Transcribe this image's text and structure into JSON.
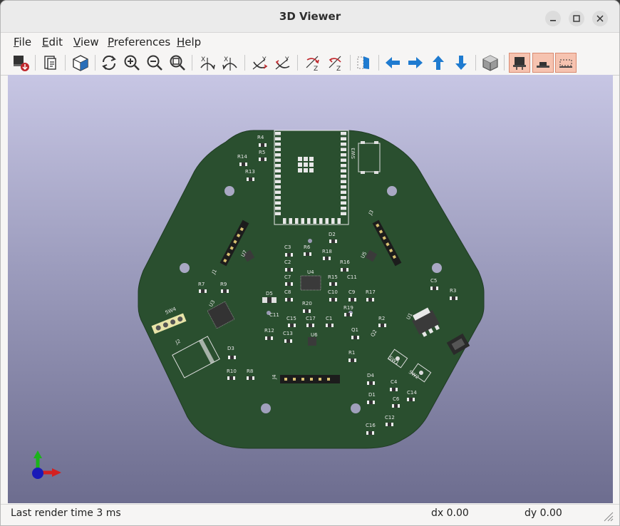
{
  "window": {
    "title": "3D Viewer"
  },
  "menu": {
    "file": "File",
    "edit": "Edit",
    "view": "View",
    "preferences": "Preferences",
    "help": "Help",
    "file_u": "F",
    "file_r": "ile",
    "edit_u": "E",
    "edit_r": "dit",
    "view_u": "V",
    "view_r": "iew",
    "pref_u": "P",
    "pref_r": "references",
    "help_u": "H",
    "help_r": "elp"
  },
  "toolbar": {
    "active_color": "#f6c3b0",
    "icon_blue": "#1f7bd0"
  },
  "board": {
    "color": "#2a4f2f",
    "labels": [
      "R4",
      "R5",
      "R14",
      "R13",
      "SW3",
      "J3",
      "D2",
      "R6",
      "R18",
      "C3",
      "U7",
      "C2",
      "R16",
      "U5",
      "J1",
      "C7",
      "U4",
      "R15",
      "C11",
      "C5",
      "R7",
      "R9",
      "C8",
      "C10",
      "C9",
      "R17",
      "R3",
      "D5",
      "R20",
      "U3",
      "R19",
      "SW4",
      "C11",
      "C15",
      "C17",
      "C1",
      "R2",
      "U1",
      "R12",
      "C13",
      "U6",
      "Q1",
      "Q2",
      "J2",
      "D3",
      "R1",
      "SW1",
      "SW2",
      "R10",
      "R8",
      "J4",
      "D4",
      "C4",
      "D1",
      "C14",
      "C6",
      "C12",
      "C16"
    ]
  },
  "status": {
    "render_time": "Last render time 3 ms",
    "dx": "dx 0.00",
    "dy": "dy 0.00"
  }
}
